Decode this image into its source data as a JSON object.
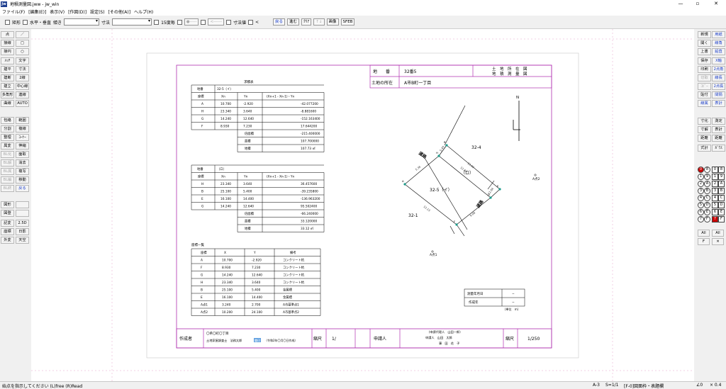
{
  "window": {
    "title": "地積測量図.jww - jw_win",
    "app_icon": "Jw",
    "controls": [
      "—",
      "▫",
      "✕"
    ]
  },
  "menu": [
    "ファイル(F)",
    "[編集(E)]",
    "表示(V)",
    "[作図(D)]",
    "設定(S)",
    "[その他(A)]",
    "ヘルプ(H)"
  ],
  "toolbar": {
    "rect_label": "矩形",
    "hv_label": "水平・垂直",
    "slope_label": "傾き",
    "dim_label": "寸法",
    "deg15_label": "15度毎",
    "circle_seg": "●-----",
    "dash_seg": "<------",
    "dimvalue_label": "寸法値",
    "lt_label": "<",
    "buttons": [
      "戻る",
      "進む",
      "ｸﾘｱ",
      "↑↓",
      "画像",
      "SFEB"
    ]
  },
  "left_tools": [
    [
      "点",
      "／"
    ],
    [
      "接線",
      "□"
    ],
    [
      "接円",
      "○"
    ],
    [
      "ﾊｯﾁ",
      "文字"
    ],
    [
      "建平",
      "寸法"
    ],
    [
      "建断",
      "2線"
    ],
    [
      "建立",
      "中心線"
    ],
    [
      "多角形",
      "連線"
    ],
    [
      "曲線",
      "AUTO"
    ],
    [
      "包絡",
      "範囲"
    ],
    [
      "分割",
      "複線"
    ],
    [
      "整理",
      "ｺｰﾅｰ"
    ],
    [
      "属変",
      "伸縮"
    ],
    [
      "BL化",
      "面取"
    ],
    [
      "BL解",
      "消去"
    ],
    [
      "BL属",
      "複写"
    ],
    [
      "BL編",
      "移動"
    ],
    [
      "BL終",
      "戻る"
    ],
    [
      "図形",
      ""
    ],
    [
      "図登",
      ""
    ],
    [
      "記変",
      "2.5D"
    ],
    [
      "座標",
      "日影"
    ],
    [
      "外変",
      "天空"
    ]
  ],
  "right_tools": [
    [
      "新規",
      "用紙"
    ],
    [
      "開く",
      "線角"
    ],
    [
      "上書",
      "鉛直"
    ],
    [
      "保存",
      "X軸"
    ],
    [
      "印刷",
      "2点角"
    ],
    [
      "切取",
      "線長"
    ],
    [
      "ｺﾋﾟｰ",
      "2点長"
    ],
    [
      "貼付",
      "間隔"
    ],
    [
      "線属",
      "表計"
    ],
    [
      "寸化",
      "測定"
    ],
    [
      "寸解",
      "表計"
    ],
    [
      "距離",
      "距離"
    ],
    [
      "式計",
      "ｶﾞｳｽ"
    ]
  ],
  "layers": {
    "left": [
      "0",
      "1",
      "2",
      "3",
      "4",
      "5",
      "6",
      "7"
    ],
    "right": [
      "8",
      "9",
      "A",
      "B",
      "C",
      "D",
      "E",
      "F"
    ],
    "right_group": [
      "0",
      "1",
      "2",
      "3",
      "4",
      "5",
      "6",
      "7"
    ],
    "right_group2": [
      "8",
      "9",
      "A",
      "B",
      "C",
      "D",
      "E",
      "F"
    ],
    "all_label": "All",
    "f_label": "F",
    "x_label": "✕"
  },
  "drawing": {
    "header": {
      "chiban_label": "地　　番",
      "chiban_value": "32番5",
      "location_label": "土地の所在",
      "location_value": "A市B町一丁目",
      "title_line1": "土　地　所　在　図",
      "title_line2": "地　積　測　量　図"
    },
    "table1": {
      "caption": "求積表",
      "lot_label": "地番",
      "lot_value": "32-5（イ）",
      "headers": [
        "座標",
        "Xn",
        "Yn",
        "(Xn+1 - Xn-1)・Yn"
      ],
      "rows": [
        [
          "A",
          "10.700",
          "-2.920",
          "-42.077200"
        ],
        [
          "H",
          "23.340",
          "3.640",
          "-8.881600"
        ],
        [
          "G",
          "14.240",
          "12.640",
          "-152.163400"
        ],
        [
          "F",
          "8.930",
          "7.230",
          "17.644200"
        ]
      ],
      "sum_label": "倍面積",
      "sum_value": "-215.400000",
      "double_label": "面積",
      "double_value": "107.700000",
      "area_label": "地積",
      "area_value": "107.73 ㎡"
    },
    "table2": {
      "lot_label": "地番",
      "lot_value": "（ロ）",
      "headers": [
        "座標",
        "Xn",
        "Yn",
        "(Xn+1 - Xn-1)・Yn"
      ],
      "rows": [
        [
          "H",
          "23.340",
          "3.640",
          "36.457600"
        ],
        [
          "B",
          "25.100",
          "5.400",
          "-39.235800"
        ],
        [
          "E",
          "16.100",
          "14.400",
          "-136.963200"
        ],
        [
          "G",
          "14.240",
          "12.640",
          "95.502400"
        ]
      ],
      "sum_label": "倍面積",
      "sum_value": "-66.240000",
      "double_label": "面積",
      "double_value": "33.120000",
      "area_label": "地積",
      "area_value": "33.12 ㎡"
    },
    "table3": {
      "caption": "座標一覧",
      "headers": [
        "座標",
        "X",
        "Y",
        "備考"
      ],
      "rows": [
        [
          "A",
          "10.700",
          "-2.920",
          "コンクリート杭"
        ],
        [
          "F",
          "8.930",
          "7.230",
          "コンクリート杭"
        ],
        [
          "G",
          "14.240",
          "12.640",
          "コンクリート杭"
        ],
        [
          "H",
          "23.340",
          "3.640",
          "コンクリート杭"
        ],
        [
          "B",
          "25.100",
          "5.400",
          "金属標"
        ],
        [
          "E",
          "16.100",
          "14.400",
          "金属標"
        ],
        [
          "A点1",
          "3.240",
          "2.700",
          "A市基準点1"
        ],
        [
          "A点2",
          "10.200",
          "24.100",
          "A市基準点2"
        ]
      ]
    },
    "map": {
      "north": "N",
      "lot_324": "32-4",
      "lot_325": "32-5（イ）",
      "lot_ro": "（ロ）",
      "lot_321": "32-1",
      "road1": "道路",
      "road2": "道路",
      "bm1": "A点1",
      "bm2": "A点2",
      "pts": [
        "A",
        "B",
        "E",
        "F",
        "G",
        "H"
      ],
      "dims": [
        "5.36",
        "12.84",
        "13.40",
        "12.13",
        "9.08",
        "5.40",
        "12.84",
        "7.58",
        "1.86",
        "2.58"
      ]
    },
    "survey_box": {
      "date_label": "測量年月日",
      "date_value": "−",
      "prep_label": "作成年",
      "prep_value": "−",
      "unit": "（単位　m）"
    },
    "footer": {
      "author_label": "作成者",
      "author_line1": "〇県〇町〇丁目",
      "author_line2": "土地家屋調査士　法務太郎",
      "author_seal": "職印",
      "author_date": "（令和2年〇月〇日作成）",
      "scale_label": "縮尺",
      "scale_value1": "1/",
      "applicant_label": "申請人",
      "applicant_line1": "（申請代理人　山田一郎）",
      "applicant_line2": "申請人　山田　太郎",
      "applicant_line3": "事　田　花　子",
      "scale_label2": "縮尺",
      "scale_value2": "1/250"
    }
  },
  "status": {
    "hint": "始点を指示してください (L)free (R)Read",
    "paper": "A-3",
    "scale": "S=1/1",
    "layer": "[F-0]図面枠・表題欄",
    "angle": "∠0",
    "zoom": "× 0.4"
  }
}
